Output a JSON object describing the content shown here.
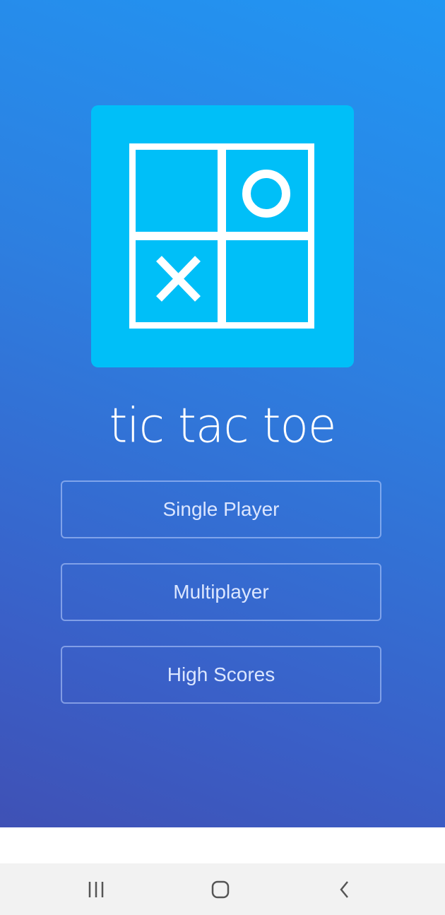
{
  "app": {
    "title": "tic tac toe",
    "logo": {
      "icon": "tic-tac-toe-board-icon",
      "background_color": "#00bff8",
      "cells": [
        "empty",
        "O",
        "X",
        "empty"
      ]
    }
  },
  "menu": {
    "single_player_label": "Single Player",
    "multiplayer_label": "Multiplayer",
    "high_scores_label": "High Scores"
  },
  "colors": {
    "gradient_top": "#2196f3",
    "gradient_bottom": "#3f51b5",
    "button_text": "#dbe6ff",
    "nav_bar": "#f2f2f2"
  },
  "system_nav": {
    "recents_icon": "recents-icon",
    "home_icon": "home-icon",
    "back_icon": "back-icon"
  }
}
